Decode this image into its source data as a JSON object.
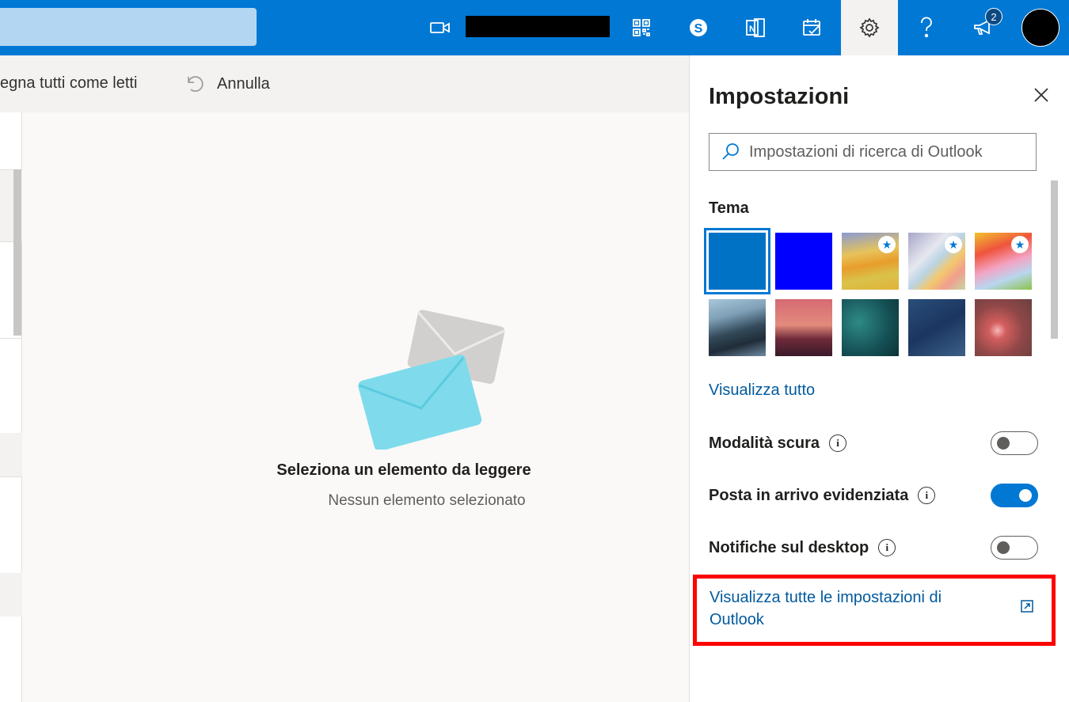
{
  "topbar": {
    "notifications_badge": "2",
    "icons": [
      "video-icon",
      "qr-code-icon",
      "skype-icon",
      "onenote-icon",
      "to-do-icon",
      "gear-icon",
      "help-icon",
      "megaphone-icon"
    ]
  },
  "commandbar": {
    "mark_all_read": "egna tutti come letti",
    "undo": "Annulla"
  },
  "reading_pane": {
    "title": "Seleziona un elemento da leggere",
    "subtitle": "Nessun elemento selezionato"
  },
  "settings": {
    "title": "Impostazioni",
    "search_placeholder": "Impostazioni di ricerca di Outlook",
    "theme_section": "Tema",
    "view_all": "Visualizza tutto",
    "dark_mode": {
      "label": "Modalità scura",
      "on": false
    },
    "focused_inbox": {
      "label": "Posta in arrivo evidenziata",
      "on": true
    },
    "desktop_notifications": {
      "label": "Notifiche sul desktop",
      "on": false
    },
    "all_settings_link": "Visualizza tutte le impostazioni di Outlook"
  },
  "colors": {
    "brand": "#0078d4",
    "link": "#005a9e",
    "highlight": "#ff0000"
  }
}
